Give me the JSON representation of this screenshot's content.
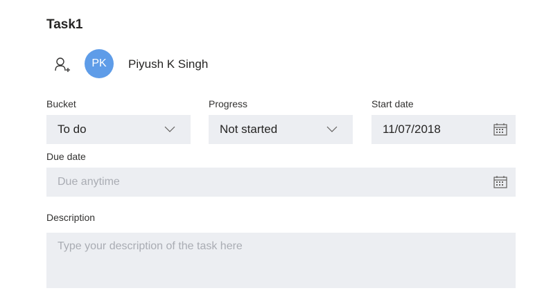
{
  "task": {
    "title": "Task1"
  },
  "assignee": {
    "initials": "PK",
    "name": "Piyush K Singh",
    "avatar_color": "#5e9ce8",
    "add_icon": "add-person-icon"
  },
  "bucket": {
    "label": "Bucket",
    "value": "To do",
    "icon": "chevron-down-icon"
  },
  "progress": {
    "label": "Progress",
    "value": "Not started",
    "icon": "chevron-down-icon"
  },
  "start_date": {
    "label": "Start date",
    "value": "11/07/2018",
    "icon": "calendar-icon"
  },
  "due_date": {
    "label": "Due date",
    "placeholder": "Due anytime",
    "icon": "calendar-icon"
  },
  "description": {
    "label": "Description",
    "placeholder": "Type your description of the task here"
  },
  "colors": {
    "field_background": "#eceef2",
    "placeholder_text": "#a9acb3",
    "text": "#252423"
  }
}
